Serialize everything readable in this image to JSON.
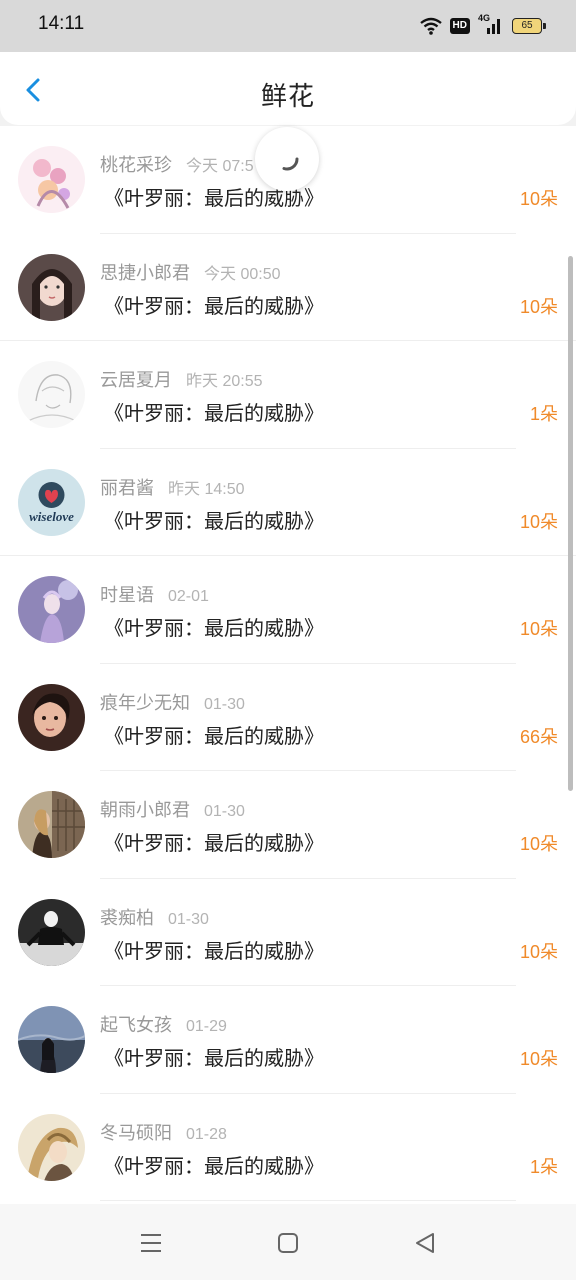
{
  "status": {
    "time": "14:11",
    "hd": "HD",
    "network": "4G",
    "battery": "65"
  },
  "header": {
    "title": "鲜花"
  },
  "icons": {
    "back": "chevron-left-icon",
    "loading": "loading-spinner-icon",
    "menu": "menu-icon",
    "home": "home-square-icon",
    "nav_back": "triangle-back-icon"
  },
  "colors": {
    "accent": "#1a8fe0",
    "count": "#f08a2a"
  },
  "list": [
    {
      "name": "桃花采珍",
      "time": "今天 07:5",
      "book": "《叶罗丽：最后的威胁》",
      "count": "10朵"
    },
    {
      "name": "思捷小郎君",
      "time": "今天 00:50",
      "book": "《叶罗丽：最后的威胁》",
      "count": "10朵"
    },
    {
      "name": "云居夏月",
      "time": "昨天 20:55",
      "book": "《叶罗丽：最后的威胁》",
      "count": "1朵"
    },
    {
      "name": "丽君酱",
      "time": "昨天 14:50",
      "book": "《叶罗丽：最后的威胁》",
      "count": "10朵",
      "avatar_text": "wiselove"
    },
    {
      "name": "时星语",
      "time": "02-01",
      "book": "《叶罗丽：最后的威胁》",
      "count": "10朵"
    },
    {
      "name": "痕年少无知",
      "time": "01-30",
      "book": "《叶罗丽：最后的威胁》",
      "count": "66朵"
    },
    {
      "name": "朝雨小郎君",
      "time": "01-30",
      "book": "《叶罗丽：最后的威胁》",
      "count": "10朵"
    },
    {
      "name": "裘痴柏",
      "time": "01-30",
      "book": "《叶罗丽：最后的威胁》",
      "count": "10朵"
    },
    {
      "name": "起飞女孩",
      "time": "01-29",
      "book": "《叶罗丽：最后的威胁》",
      "count": "10朵"
    },
    {
      "name": "冬马硕阳",
      "time": "01-28",
      "book": "《叶罗丽：最后的威胁》",
      "count": "1朵"
    }
  ]
}
